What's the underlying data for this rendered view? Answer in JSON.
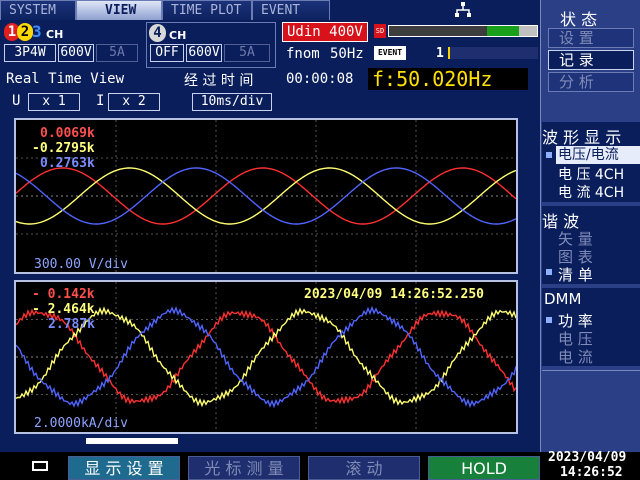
{
  "tabs": [
    "SYSTEM",
    "VIEW",
    "TIME PLOT",
    "EVENT"
  ],
  "channels": {
    "ch_marks": [
      "1",
      "2",
      "3"
    ],
    "ch_suffix": "CH",
    "wiring": "3P4W",
    "voltage_range": "600V",
    "current_range": "5A",
    "ch4_mark": "4",
    "ch4_suffix": "CH",
    "ch4_state": "OFF",
    "ch4_voltage": "600V",
    "ch4_current": "5A"
  },
  "settings": {
    "udin": "Udin 400V",
    "fnom": "fnom",
    "fnom_value": "50Hz",
    "sd_label": "SD",
    "event_label": "EVENT",
    "event_count": "1"
  },
  "status_row": {
    "view_name": "Real Time View",
    "elapsed_label": "经 过 时 间",
    "elapsed": "00:00:08",
    "freq_label": "f:50.020Hz"
  },
  "scale_row": {
    "u_label": "U",
    "u_scale": "x 1",
    "i_label": "I",
    "i_scale": "x 2",
    "timebase": "10ms/div"
  },
  "voltage_panel": {
    "values": [
      {
        "text": "0.0069k",
        "color": "#ff5050"
      },
      {
        "text": "-0.2795k",
        "color": "#ffff80"
      },
      {
        "text": "0.2763k",
        "color": "#7a8cff"
      }
    ],
    "div": "300.00 V/div"
  },
  "current_panel": {
    "values": [
      {
        "text": "- 0.142k",
        "color": "#ff5050"
      },
      {
        "text": "- 2.464k",
        "color": "#ffff80"
      },
      {
        "text": "2.787k",
        "color": "#7a8cff"
      }
    ],
    "timestamp": "2023/04/09 14:26:52.250",
    "div": "2.0000kA/div"
  },
  "right_panel": {
    "status_title": "状 态",
    "status_items": [
      {
        "label": "设 置",
        "active": false
      },
      {
        "label": "记 录",
        "active": true
      },
      {
        "label": "分 析",
        "active": false
      }
    ],
    "wave_title": "波 形 显 示",
    "wave_items": [
      {
        "label": "电压/电流",
        "selected": true
      },
      {
        "label": "电 压 4CH",
        "selected": false
      },
      {
        "label": "电 流 4CH",
        "selected": false
      }
    ],
    "harm_title": "谐 波",
    "harm_items": [
      {
        "label": "矢 量"
      },
      {
        "label": "图 表"
      },
      {
        "label": "清 单"
      }
    ],
    "dmm_title": "DMM",
    "dmm_items": [
      {
        "label": "功 率"
      },
      {
        "label": "电 压"
      },
      {
        "label": "电 流"
      }
    ]
  },
  "footer": {
    "btn_display": "显 示 设 置",
    "btn_cursor": "光 标 测 量",
    "btn_scroll": "滚 动",
    "btn_hold": "HOLD",
    "date": "2023/04/09",
    "time": "14:26:52"
  },
  "wave_colors": {
    "phase1": "#ff3030",
    "phase2": "#ffff70",
    "phase3": "#5064ff"
  },
  "chart_data": [
    {
      "type": "line",
      "title": "",
      "ylabel": "300.00 V/div",
      "series": [
        {
          "values": [
            0.0069
          ],
          "color": "#ff3030"
        },
        {
          "values": [
            -0.2795
          ],
          "color": "#ffff70"
        },
        {
          "values": [
            0.2763
          ],
          "color": "#5064ff"
        }
      ]
    },
    {
      "type": "line",
      "title": "",
      "ylabel": "2.0000kA/div",
      "series": [
        {
          "values": [
            -0.142
          ],
          "color": "#ff3030"
        },
        {
          "values": [
            -2.464
          ],
          "color": "#ffff70"
        },
        {
          "values": [
            2.787
          ],
          "color": "#5064ff"
        }
      ]
    }
  ]
}
